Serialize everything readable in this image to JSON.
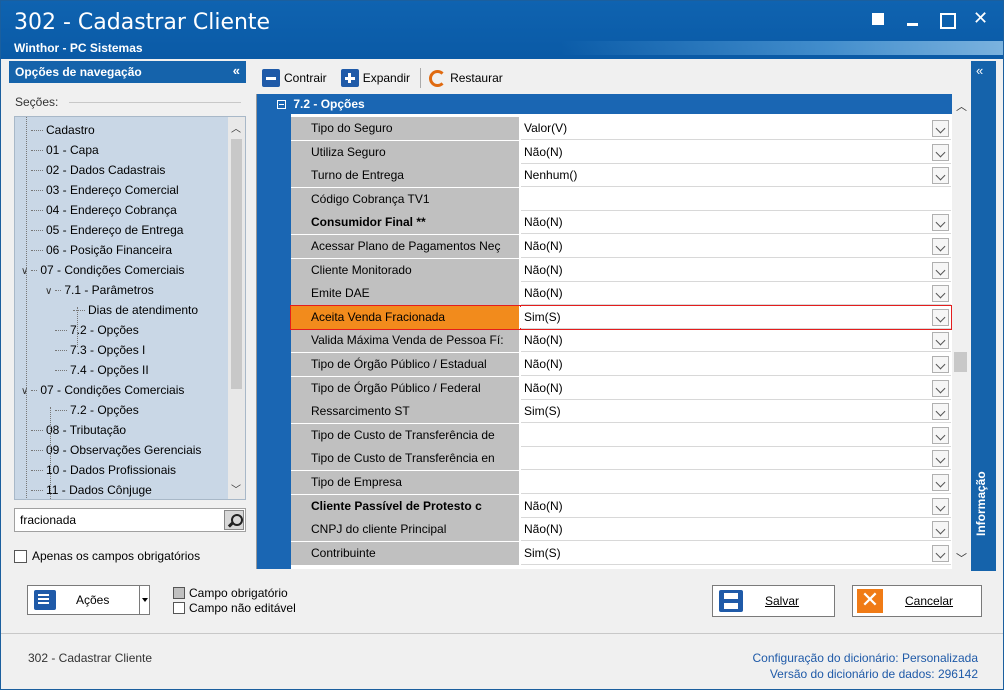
{
  "window": {
    "title": "302 - Cadastrar Cliente",
    "subtitle": "Winthor - PC Sistemas"
  },
  "nav": {
    "header": "Opções de navegação",
    "collapse_glyph": "«",
    "sections_label": "Seções:",
    "tree": [
      {
        "label": "Cadastro"
      },
      {
        "label": "01 - Capa"
      },
      {
        "label": "02 - Dados Cadastrais"
      },
      {
        "label": "03 - Endereço Comercial"
      },
      {
        "label": "04 - Endereço Cobrança"
      },
      {
        "label": "05 - Endereço de Entrega"
      },
      {
        "label": "06 - Posição Financeira"
      },
      {
        "label": "07 - Condições Comerciais"
      },
      {
        "label": "7.1 - Parâmetros"
      },
      {
        "label": "Dias de atendimento"
      },
      {
        "label": "7.2 - Opções"
      },
      {
        "label": "7.3 - Opções I"
      },
      {
        "label": "7.4 - Opções II"
      },
      {
        "label": "07 - Condições Comerciais"
      },
      {
        "label": "7.2 - Opções"
      },
      {
        "label": "08 - Tributação"
      },
      {
        "label": "09 - Observações Gerenciais"
      },
      {
        "label": "10 - Dados Profissionais"
      },
      {
        "label": "11 - Dados Cônjuge"
      }
    ],
    "search_value": "fracionada",
    "only_required_label": "Apenas os campos obrigatórios"
  },
  "toolbar": {
    "contrair": "Contrair",
    "expandir": "Expandir",
    "restaurar": "Restaurar"
  },
  "info_panel": {
    "collapse_glyph": "«",
    "label": "Informação"
  },
  "grid": {
    "section_title": "7.2 - Opções",
    "rows": [
      {
        "label": "Tipo do Seguro",
        "value": "Valor(V)",
        "bold": false,
        "dropdown": true
      },
      {
        "label": "Utiliza Seguro",
        "value": "Não(N)",
        "bold": false,
        "dropdown": true
      },
      {
        "label": "Turno de Entrega",
        "value": "Nenhum()",
        "bold": false,
        "dropdown": true
      },
      {
        "label": "Código Cobrança TV1",
        "value": "",
        "bold": false,
        "dropdown": false
      },
      {
        "label": "Consumidor Final **",
        "value": "Não(N)",
        "bold": true,
        "dropdown": true
      },
      {
        "label": "Acessar Plano de Pagamentos Neç",
        "value": "Não(N)",
        "bold": false,
        "dropdown": true
      },
      {
        "label": "Cliente Monitorado",
        "value": "Não(N)",
        "bold": false,
        "dropdown": true
      },
      {
        "label": "Emite DAE",
        "value": "Não(N)",
        "bold": false,
        "dropdown": true
      },
      {
        "label": "Aceita Venda Fracionada",
        "value": "Sim(S)",
        "bold": false,
        "dropdown": true,
        "highlight": true
      },
      {
        "label": "Valida Máxima Venda de Pessoa Fí:",
        "value": "Não(N)",
        "bold": false,
        "dropdown": true
      },
      {
        "label": "Tipo de Órgão Público / Estadual",
        "value": "Não(N)",
        "bold": false,
        "dropdown": true
      },
      {
        "label": "Tipo de Órgão Público / Federal",
        "value": "Não(N)",
        "bold": false,
        "dropdown": true
      },
      {
        "label": "Ressarcimento ST",
        "value": "Sim(S)",
        "bold": false,
        "dropdown": true
      },
      {
        "label": "Tipo de Custo de Transferência de",
        "value": "",
        "bold": false,
        "dropdown": true
      },
      {
        "label": "Tipo de Custo de Transferência en",
        "value": "",
        "bold": false,
        "dropdown": true
      },
      {
        "label": "Tipo de Empresa",
        "value": "",
        "bold": false,
        "dropdown": true
      },
      {
        "label": "Cliente Passível de Protesto c",
        "value": "Não(N)",
        "bold": true,
        "dropdown": true
      },
      {
        "label": "CNPJ do cliente Principal",
        "value": "Não(N)",
        "bold": false,
        "dropdown": true
      },
      {
        "label": "Contribuinte",
        "value": "Sim(S)",
        "bold": false,
        "dropdown": true
      }
    ]
  },
  "bottom": {
    "acoes": "Ações",
    "legend_required": "Campo obrigatório",
    "legend_readonly": "Campo não editável",
    "salvar": "Salvar",
    "cancelar": "Cancelar"
  },
  "status": {
    "left": "302 - Cadastrar Cliente",
    "dict_config_label": "Configuração do dicionário:",
    "dict_config_value": "Personalizada",
    "dict_version_label": "Versão do dicionário de dados:",
    "dict_version_value": "296142"
  },
  "colors": {
    "brand_blue": "#1563ab",
    "highlight_orange": "#f28b1c",
    "highlight_border": "#e41d1d"
  }
}
